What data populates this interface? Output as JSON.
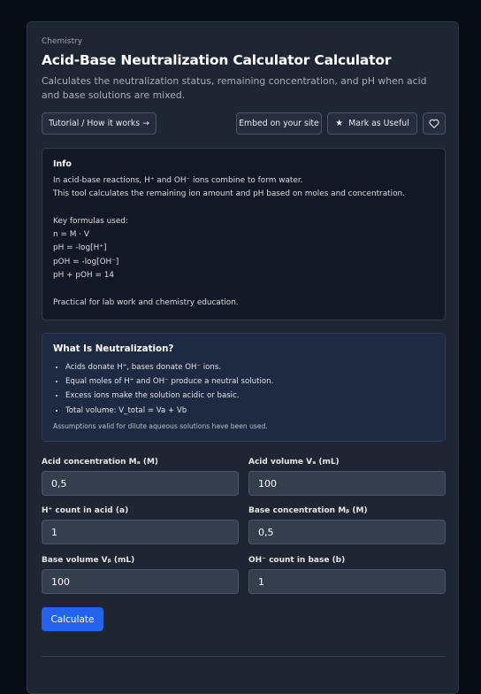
{
  "header": {
    "breadcrumb": "Chemistry",
    "title": "Acid-Base Neutralization Calculator Calculator",
    "description": "Calculates the neutralization status, remaining concentration, and pH when acid and base solutions are mixed."
  },
  "actions": {
    "tutorial_label": "Tutorial / How it works →",
    "embed_label": "Embed on your site",
    "useful_label": "Mark as Useful",
    "useful_icon": "star-icon",
    "favorite_icon": "heart-icon"
  },
  "info": {
    "title": "Info",
    "lines": [
      "In acid-base reactions, H⁺ and OH⁻ ions combine to form water.",
      "This tool calculates the remaining ion amount and pH based on moles and concentration.",
      "",
      "Key formulas used:",
      "n = M · V",
      "pH = -log[H⁺]",
      "pOH = -log[OH⁻]",
      "pH + pOH = 14",
      "",
      "Practical for lab work and chemistry education."
    ]
  },
  "neutralization": {
    "title": "What Is Neutralization?",
    "bullets": [
      "Acids donate H⁺, bases donate OH⁻ ions.",
      "Equal moles of H⁺ and OH⁻ produce a neutral solution.",
      "Excess ions make the solution acidic or basic.",
      "Total volume: V_total = Va + Vb"
    ],
    "note": "Assumptions valid for dilute aqueous solutions have been used."
  },
  "form": {
    "acid_conc": {
      "label": "Acid concentration Mₐ (M)",
      "value": "0,5"
    },
    "acid_vol": {
      "label": "Acid volume Vₐ (mL)",
      "value": "100"
    },
    "h_count": {
      "label": "H⁺ count in acid (a)",
      "value": "1"
    },
    "base_conc": {
      "label": "Base concentration Mᵦ (M)",
      "value": "0,5"
    },
    "base_vol": {
      "label": "Base volume Vᵦ (mL)",
      "value": "100"
    },
    "oh_count": {
      "label": "OH⁻ count in base (b)",
      "value": "1"
    },
    "calculate_label": "Calculate"
  }
}
